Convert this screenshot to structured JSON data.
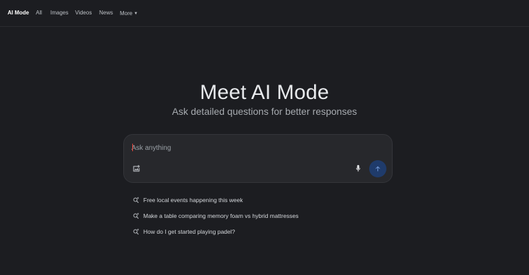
{
  "nav": {
    "tabs": [
      {
        "label": "AI Mode",
        "active": true
      },
      {
        "label": "All",
        "active": false
      },
      {
        "label": "Images",
        "active": false
      },
      {
        "label": "Videos",
        "active": false
      },
      {
        "label": "News",
        "active": false
      }
    ],
    "more_label": "More"
  },
  "hero": {
    "title": "Meet AI Mode",
    "subtitle": "Ask detailed questions for better responses"
  },
  "search": {
    "placeholder": "Ask anything",
    "value": "",
    "icons": {
      "upload": "image-upload-icon",
      "mic": "microphone-icon",
      "send": "arrow-up-icon"
    }
  },
  "suggestions": [
    {
      "text": "Free local events happening this week",
      "icon": "search-sparkle-icon"
    },
    {
      "text": "Make a table comparing memory foam vs hybrid mattresses",
      "icon": "search-sparkle-icon"
    },
    {
      "text": "How do I get started playing padel?",
      "icon": "search-sparkle-icon"
    }
  ],
  "colors": {
    "background": "#1c1d21",
    "searchbox": "#27282c",
    "send_button": "#1f3b6b",
    "text_primary": "#e8eaed",
    "text_secondary": "#a7abb0"
  }
}
